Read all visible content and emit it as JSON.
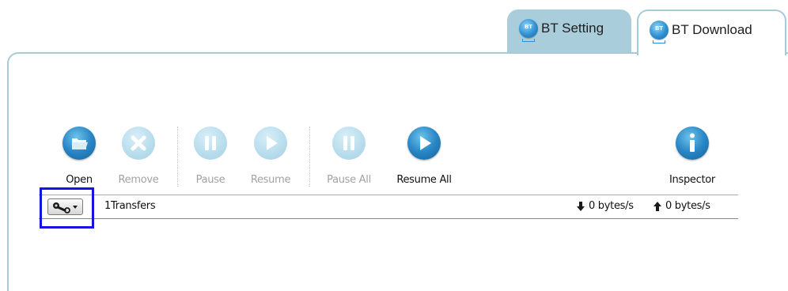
{
  "tabs": [
    {
      "label": "BT Setting",
      "icon": "bt-icon",
      "active": false
    },
    {
      "label": "BT Download",
      "icon": "bt-icon",
      "active": true
    }
  ],
  "toolbar": {
    "open": {
      "label": "Open",
      "icon": "folder-icon",
      "enabled": true
    },
    "remove": {
      "label": "Remove",
      "icon": "x-icon",
      "enabled": false
    },
    "pause": {
      "label": "Pause",
      "icon": "pause-icon",
      "enabled": false
    },
    "resume": {
      "label": "Resume",
      "icon": "play-icon",
      "enabled": false
    },
    "pause_all": {
      "label": "Pause All",
      "icon": "pause-icon",
      "enabled": false
    },
    "resume_all": {
      "label": "Resume All",
      "icon": "play-icon",
      "enabled": true
    },
    "inspector": {
      "label": "Inspector",
      "icon": "info-icon",
      "enabled": true
    }
  },
  "status": {
    "action_menu_icon": "wrench-dropdown-icon",
    "transfers": "1Transfers",
    "download_rate": "0 bytes/s",
    "upload_rate": "0 bytes/s"
  },
  "colors": {
    "tab_inactive_bg": "#a9cddb",
    "panel_border": "#a5cbd9",
    "icon_enabled": "#2a86c5",
    "icon_disabled": "#b7dcec",
    "highlight": "#1414e0"
  }
}
